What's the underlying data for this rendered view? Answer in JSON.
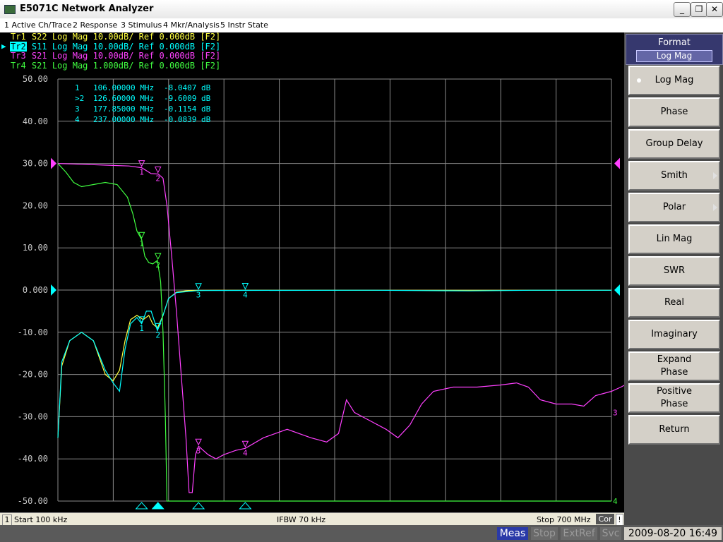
{
  "window": {
    "title": "E5071C Network Analyzer",
    "btn_min": "_",
    "btn_restore": "❐",
    "btn_close": "✕"
  },
  "menu": [
    "1 Active Ch/Trace",
    "2 Response",
    "3 Stimulus",
    "4 Mkr/Analysis",
    "5 Instr State"
  ],
  "traces": [
    {
      "label": "Tr1",
      "text": "S22 Log Mag 10.00dB/ Ref 0.000dB [F2]",
      "color": "#ffff40"
    },
    {
      "label": "Tr2",
      "text": "S11 Log Mag 10.00dB/ Ref 0.000dB [F2]",
      "color": "#00ffff",
      "active": true
    },
    {
      "label": "Tr3",
      "text": "S21 Log Mag 10.00dB/ Ref 0.000dB [F2]",
      "color": "#ff40ff"
    },
    {
      "label": "Tr4",
      "text": "S21 Log Mag 1.000dB/ Ref 0.000dB [F2]",
      "color": "#40ff40"
    }
  ],
  "markers_table": [
    {
      "id": " 1",
      "freq": "106.00000 MHz",
      "value": "-8.0407 dB"
    },
    {
      "id": ">2",
      "freq": "126.60000 MHz",
      "value": "-9.6009 dB"
    },
    {
      "id": " 3",
      "freq": "177.85000 MHz",
      "value": "-0.1154 dB"
    },
    {
      "id": " 4",
      "freq": "237.00000 MHz",
      "value": "-0.0839 dB"
    }
  ],
  "chart_data": {
    "type": "line",
    "y_ticks": [
      "50.00",
      "40.00",
      "30.00",
      "20.00",
      "10.00",
      "0.000",
      "-10.00",
      "-20.00",
      "-30.00",
      "-40.00",
      "-50.00"
    ],
    "ylim": [
      -50,
      50
    ],
    "xlim_mhz": [
      0.1,
      700
    ],
    "grid": true,
    "x_divisions": 10,
    "series": [
      {
        "color": "#ffff40",
        "points": [
          [
            0.1,
            -35
          ],
          [
            5,
            -18
          ],
          [
            15,
            -12
          ],
          [
            30,
            -10
          ],
          [
            45,
            -12
          ],
          [
            60,
            -20
          ],
          [
            70,
            -21.5
          ],
          [
            78,
            -19
          ],
          [
            85,
            -12
          ],
          [
            92,
            -7
          ],
          [
            100,
            -6
          ],
          [
            108,
            -7
          ],
          [
            115,
            -6
          ],
          [
            120,
            -8
          ],
          [
            126,
            -9
          ],
          [
            133,
            -6
          ],
          [
            140,
            -2
          ],
          [
            150,
            -0.5
          ],
          [
            165,
            -0.1
          ],
          [
            200,
            -0.05
          ],
          [
            400,
            -0.05
          ],
          [
            600,
            -0.05
          ],
          [
            700,
            -0.05
          ]
        ]
      },
      {
        "color": "#00ffff",
        "points": [
          [
            0.1,
            -35
          ],
          [
            5,
            -17
          ],
          [
            15,
            -12
          ],
          [
            30,
            -10
          ],
          [
            45,
            -12
          ],
          [
            60,
            -19
          ],
          [
            70,
            -22
          ],
          [
            78,
            -24
          ],
          [
            85,
            -14
          ],
          [
            92,
            -8
          ],
          [
            100,
            -6.5
          ],
          [
            106,
            -8
          ],
          [
            112,
            -5
          ],
          [
            118,
            -5
          ],
          [
            126,
            -9.6
          ],
          [
            133,
            -6
          ],
          [
            140,
            -2
          ],
          [
            150,
            -0.6
          ],
          [
            178,
            -0.12
          ],
          [
            237,
            -0.08
          ],
          [
            400,
            -0.05
          ],
          [
            520,
            -0.2
          ],
          [
            600,
            -0.05
          ],
          [
            700,
            -0.05
          ]
        ]
      },
      {
        "color": "#ff40ff",
        "points": [
          [
            0.1,
            30
          ],
          [
            30,
            29.8
          ],
          [
            60,
            29.6
          ],
          [
            90,
            29.4
          ],
          [
            106,
            29
          ],
          [
            118,
            27.6
          ],
          [
            127,
            27.5
          ],
          [
            133,
            26.5
          ],
          [
            138,
            20
          ],
          [
            144,
            8
          ],
          [
            150,
            -5
          ],
          [
            156,
            -20
          ],
          [
            162,
            -35
          ],
          [
            166,
            -48
          ],
          [
            170,
            -48
          ],
          [
            174,
            -39
          ],
          [
            178,
            -37
          ],
          [
            190,
            -39
          ],
          [
            200,
            -40
          ],
          [
            210,
            -39
          ],
          [
            225,
            -38
          ],
          [
            237,
            -37.5
          ],
          [
            260,
            -35
          ],
          [
            290,
            -33
          ],
          [
            320,
            -35
          ],
          [
            340,
            -36
          ],
          [
            355,
            -34
          ],
          [
            365,
            -26
          ],
          [
            375,
            -29
          ],
          [
            395,
            -31
          ],
          [
            415,
            -33
          ],
          [
            430,
            -35
          ],
          [
            445,
            -32
          ],
          [
            460,
            -27
          ],
          [
            475,
            -24
          ],
          [
            500,
            -23
          ],
          [
            530,
            -23
          ],
          [
            560,
            -22.5
          ],
          [
            580,
            -22
          ],
          [
            595,
            -23
          ],
          [
            610,
            -26
          ],
          [
            630,
            -27
          ],
          [
            650,
            -27
          ],
          [
            665,
            -27.5
          ],
          [
            680,
            -25
          ],
          [
            700,
            -24
          ],
          [
            712,
            -23
          ],
          [
            722,
            -22
          ],
          [
            735,
            -25
          ],
          [
            750,
            -27
          ],
          [
            770,
            -29
          ]
        ]
      },
      {
        "color": "#40ff40",
        "points": [
          [
            0.1,
            30
          ],
          [
            10,
            28
          ],
          [
            20,
            25.5
          ],
          [
            30,
            24.5
          ],
          [
            45,
            25
          ],
          [
            60,
            25.5
          ],
          [
            75,
            25
          ],
          [
            88,
            22
          ],
          [
            95,
            18
          ],
          [
            100,
            14
          ],
          [
            106,
            12
          ],
          [
            110,
            8
          ],
          [
            115,
            6.5
          ],
          [
            120,
            6.2
          ],
          [
            126,
            7
          ],
          [
            130,
            2
          ],
          [
            133,
            -10
          ],
          [
            136,
            -30
          ],
          [
            138,
            -50
          ],
          [
            140,
            -50
          ],
          [
            700,
            -50
          ]
        ]
      }
    ],
    "markers": [
      {
        "series": 2,
        "id": "1",
        "x": 106,
        "y": 29
      },
      {
        "series": 2,
        "id": "2",
        "x": 126.6,
        "y": 27.5
      },
      {
        "series": 2,
        "id": "3",
        "x": 177.85,
        "y": -37
      },
      {
        "series": 2,
        "id": "4",
        "x": 237,
        "y": -37.5
      },
      {
        "series": 3,
        "id": "1",
        "x": 106,
        "y": 12
      },
      {
        "series": 3,
        "id": "2",
        "x": 126.6,
        "y": 7
      },
      {
        "series": 1,
        "id": "1",
        "x": 106,
        "y": -8
      },
      {
        "series": 1,
        "id": "2",
        "x": 126.6,
        "y": -9.6
      },
      {
        "series": 1,
        "id": "3",
        "x": 177.85,
        "y": -0.12
      },
      {
        "series": 1,
        "id": "4",
        "x": 237,
        "y": -0.08
      }
    ],
    "ref_arrows": [
      {
        "side": "left",
        "y": 30,
        "color": "#ff40ff"
      },
      {
        "side": "left",
        "y": 0,
        "color": "#00ffff"
      },
      {
        "side": "right",
        "y": 30,
        "color": "#ff40ff"
      },
      {
        "side": "right",
        "y": 0,
        "color": "#00ffff"
      }
    ],
    "end_labels": [
      {
        "text": "3",
        "y": -29,
        "color": "#ff40ff"
      },
      {
        "text": "4",
        "y": -50,
        "color": "#40ff40"
      }
    ]
  },
  "status": {
    "channel": "1",
    "start": "Start 100 kHz",
    "ifbw": "IFBW 70 kHz",
    "stop": "Stop 700 MHz",
    "cor": "Cor",
    "excl": "!"
  },
  "bottom": {
    "meas": "Meas",
    "stop": "Stop",
    "extref": "ExtRef",
    "svc": "Svc",
    "datetime": "2009-08-20 16:49"
  },
  "softkeys": {
    "title": "Format",
    "value": "Log Mag",
    "buttons": [
      {
        "label": "Log Mag",
        "selected": true
      },
      {
        "label": "Phase"
      },
      {
        "label": "Group Delay"
      },
      {
        "label": "Smith",
        "submenu": true
      },
      {
        "label": "Polar",
        "submenu": true
      },
      {
        "label": "Lin Mag"
      },
      {
        "label": "SWR"
      },
      {
        "label": "Real"
      },
      {
        "label": "Imaginary"
      },
      {
        "label": "Expand\nPhase"
      },
      {
        "label": "Positive\nPhase"
      },
      {
        "label": "Return"
      }
    ]
  }
}
